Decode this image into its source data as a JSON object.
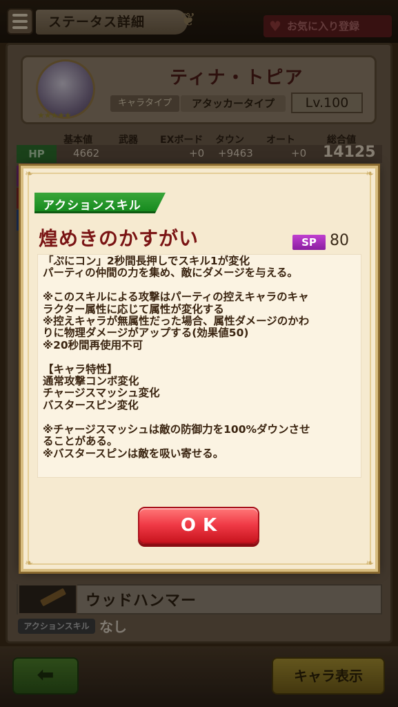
{
  "header": {
    "title": "ステータス詳細",
    "favorite_label": "お気に入り登録"
  },
  "character": {
    "name": "ティナ・トピア",
    "type_label": "キャラタイプ",
    "type_value": "アタッカータイプ",
    "level": "Lv.100",
    "stars": "★★★★★"
  },
  "stats": {
    "headers": [
      "基本値",
      "武器",
      "EXボード",
      "タウン",
      "オート",
      "総合値"
    ],
    "hp_label": "HP",
    "hp_values": [
      "4662",
      "",
      "+0",
      "+9463",
      "+0"
    ],
    "hp_total": "14125"
  },
  "weapon": {
    "name": "ウッドハンマー",
    "action_skill_label": "アクションスキル",
    "action_skill_value": "なし"
  },
  "footer": {
    "back_icon": "arrow-left-icon",
    "chara_button_label": "キャラ表示"
  },
  "dialog": {
    "tag": "アクションスキル",
    "skill_name": "煌めきのかすがい",
    "sp_label": "SP",
    "sp_value": "80",
    "description": "「ぷにコン」2秒間長押しでスキル1が変化\nパーティの仲間の力を集め、敵にダメージを与える。\n\n※このスキルによる攻撃はパーティの控えキャラのキャ\nラクター属性に応じて属性が変化する\n※控えキャラが無属性だった場合、属性ダメージのかわ\nりに物理ダメージがアップする(効果値50)\n※20秒間再使用不可\n\n【キャラ特性】\n通常攻撃コンボ変化\nチャージスマッシュ変化\nバスタースピン変化\n\n※チャージスマッシュは敵の防御力を100%ダウンさせ\nることがある。\n※バスタースピンは敵を吸い寄せる。",
    "ok_label": "OK"
  },
  "colors": {
    "tag_green": "#168a1e",
    "skill_name_red": "#7a1414",
    "sp_purple": "#a02eb8",
    "ok_red": "#f03a46",
    "dialog_bg": "#f6ead0"
  }
}
